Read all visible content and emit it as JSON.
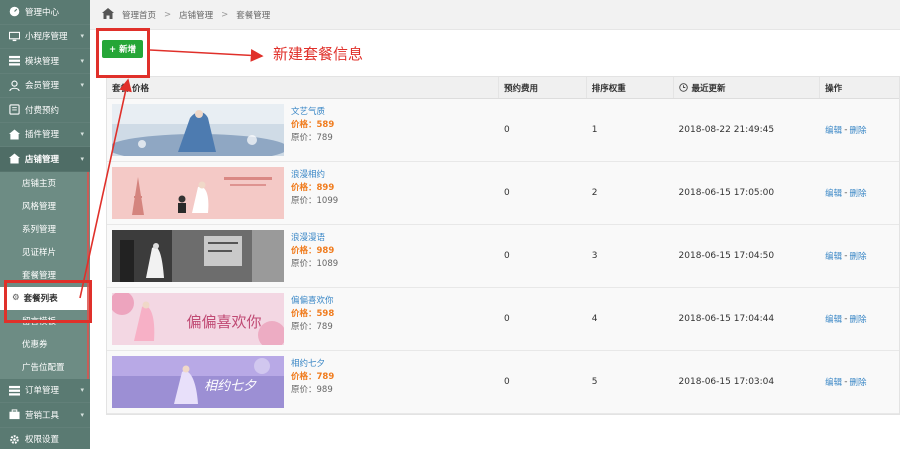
{
  "sidebar": {
    "items": [
      {
        "icon": "dashboard-icon",
        "label": "管理中心",
        "chev": ""
      },
      {
        "icon": "monitor-icon",
        "label": "小程序管理",
        "chev": "▾"
      },
      {
        "icon": "module-icon",
        "label": "模块管理",
        "chev": "▾"
      },
      {
        "icon": "user-icon",
        "label": "会员管理",
        "chev": "▾"
      },
      {
        "icon": "payment-icon",
        "label": "付费预约",
        "chev": ""
      },
      {
        "icon": "plugin-icon",
        "label": "插件管理",
        "chev": "▾"
      },
      {
        "icon": "store-icon",
        "label": "店铺管理",
        "chev": "▾"
      }
    ],
    "sub_items": [
      "店铺主页",
      "风格管理",
      "系列管理",
      "见证样片",
      "套餐管理"
    ],
    "current_item": "套餐列表",
    "after_items": [
      "留言模板",
      "优惠券",
      "广告位配置"
    ],
    "bottom_items": [
      {
        "icon": "order-icon",
        "label": "订单管理",
        "chev": "▾"
      },
      {
        "icon": "marketing-icon",
        "label": "营销工具",
        "chev": "▾"
      },
      {
        "icon": "gear-icon",
        "label": "权限设置",
        "chev": ""
      }
    ]
  },
  "breadcrumb": {
    "home": "管理首页",
    "store": "店铺管理",
    "current": "套餐管理",
    "sep": ">"
  },
  "toolbar": {
    "add_label": "+ 新增"
  },
  "annotation": {
    "text": "新建套餐信息",
    "color": "#e0302a"
  },
  "table": {
    "headers": {
      "package": "套餐  价格",
      "fee": "预约费用",
      "weight": "排序权重",
      "updated": "最近更新",
      "ops": "操作"
    },
    "price_prefix": "价格：",
    "orig_prefix": "原价：",
    "edit_label": "编辑",
    "delete_label": "删除",
    "rows": [
      {
        "name": "文艺气质",
        "price": "589",
        "orig": "789",
        "fee": "0",
        "weight": "1",
        "updated": "2018-08-22 21:49:45",
        "theme": "blue"
      },
      {
        "name": "浪漫相约",
        "price": "899",
        "orig": "1099",
        "fee": "0",
        "weight": "2",
        "updated": "2018-06-15 17:05:00",
        "theme": "pink"
      },
      {
        "name": "浪漫漫语",
        "price": "989",
        "orig": "1089",
        "fee": "0",
        "weight": "3",
        "updated": "2018-06-15 17:04:50",
        "theme": "mono"
      },
      {
        "name": "偏偏喜欢你",
        "price": "598",
        "orig": "789",
        "fee": "0",
        "weight": "4",
        "updated": "2018-06-15 17:04:44",
        "theme": "flower"
      },
      {
        "name": "相约七夕",
        "price": "789",
        "orig": "989",
        "fee": "0",
        "weight": "5",
        "updated": "2018-06-15 17:03:04",
        "theme": "purple"
      }
    ]
  },
  "thumb_text": {
    "flower": "偏偏喜欢你",
    "purple": "相约七夕"
  },
  "colors": {
    "sidebar": "#5a7a72",
    "accent_blue": "#3a87c6",
    "price_orange": "#f07c1e",
    "add_green": "#25a637"
  }
}
